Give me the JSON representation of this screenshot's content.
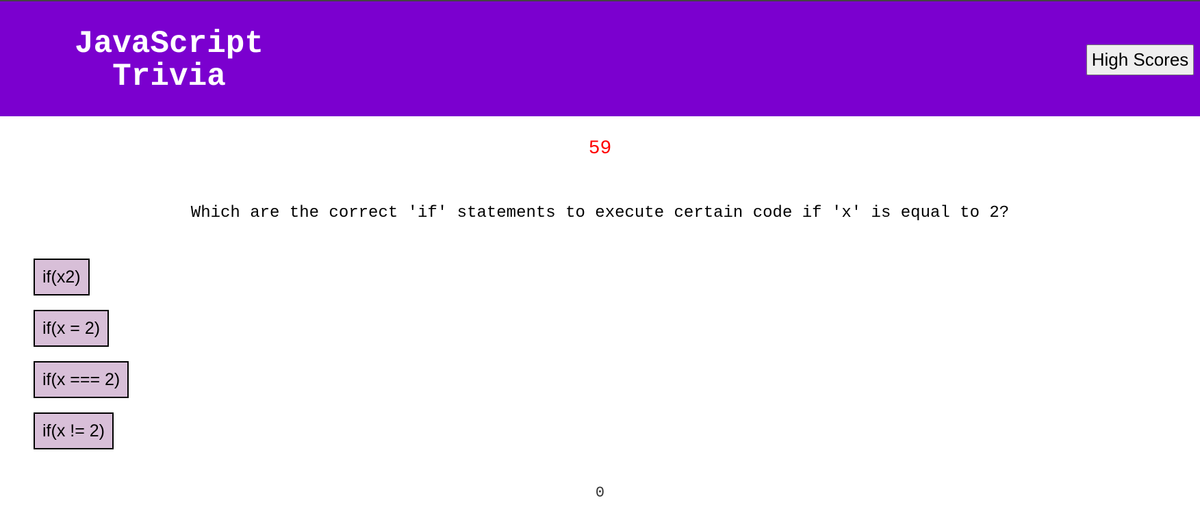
{
  "header": {
    "title": "JavaScript Trivia",
    "high_scores_label": "High Scores"
  },
  "quiz": {
    "timer": "59",
    "question": "Which are the correct 'if' statements to execute certain code if 'x' is equal to 2?",
    "answers": [
      {
        "label": "if(x2)"
      },
      {
        "label": "if(x = 2)"
      },
      {
        "label": "if(x === 2)"
      },
      {
        "label": "if(x != 2)"
      }
    ],
    "score": "0"
  },
  "colors": {
    "header_bg": "#7b00cf",
    "timer": "#ff0000",
    "answer_bg": "#d8bfd8"
  }
}
